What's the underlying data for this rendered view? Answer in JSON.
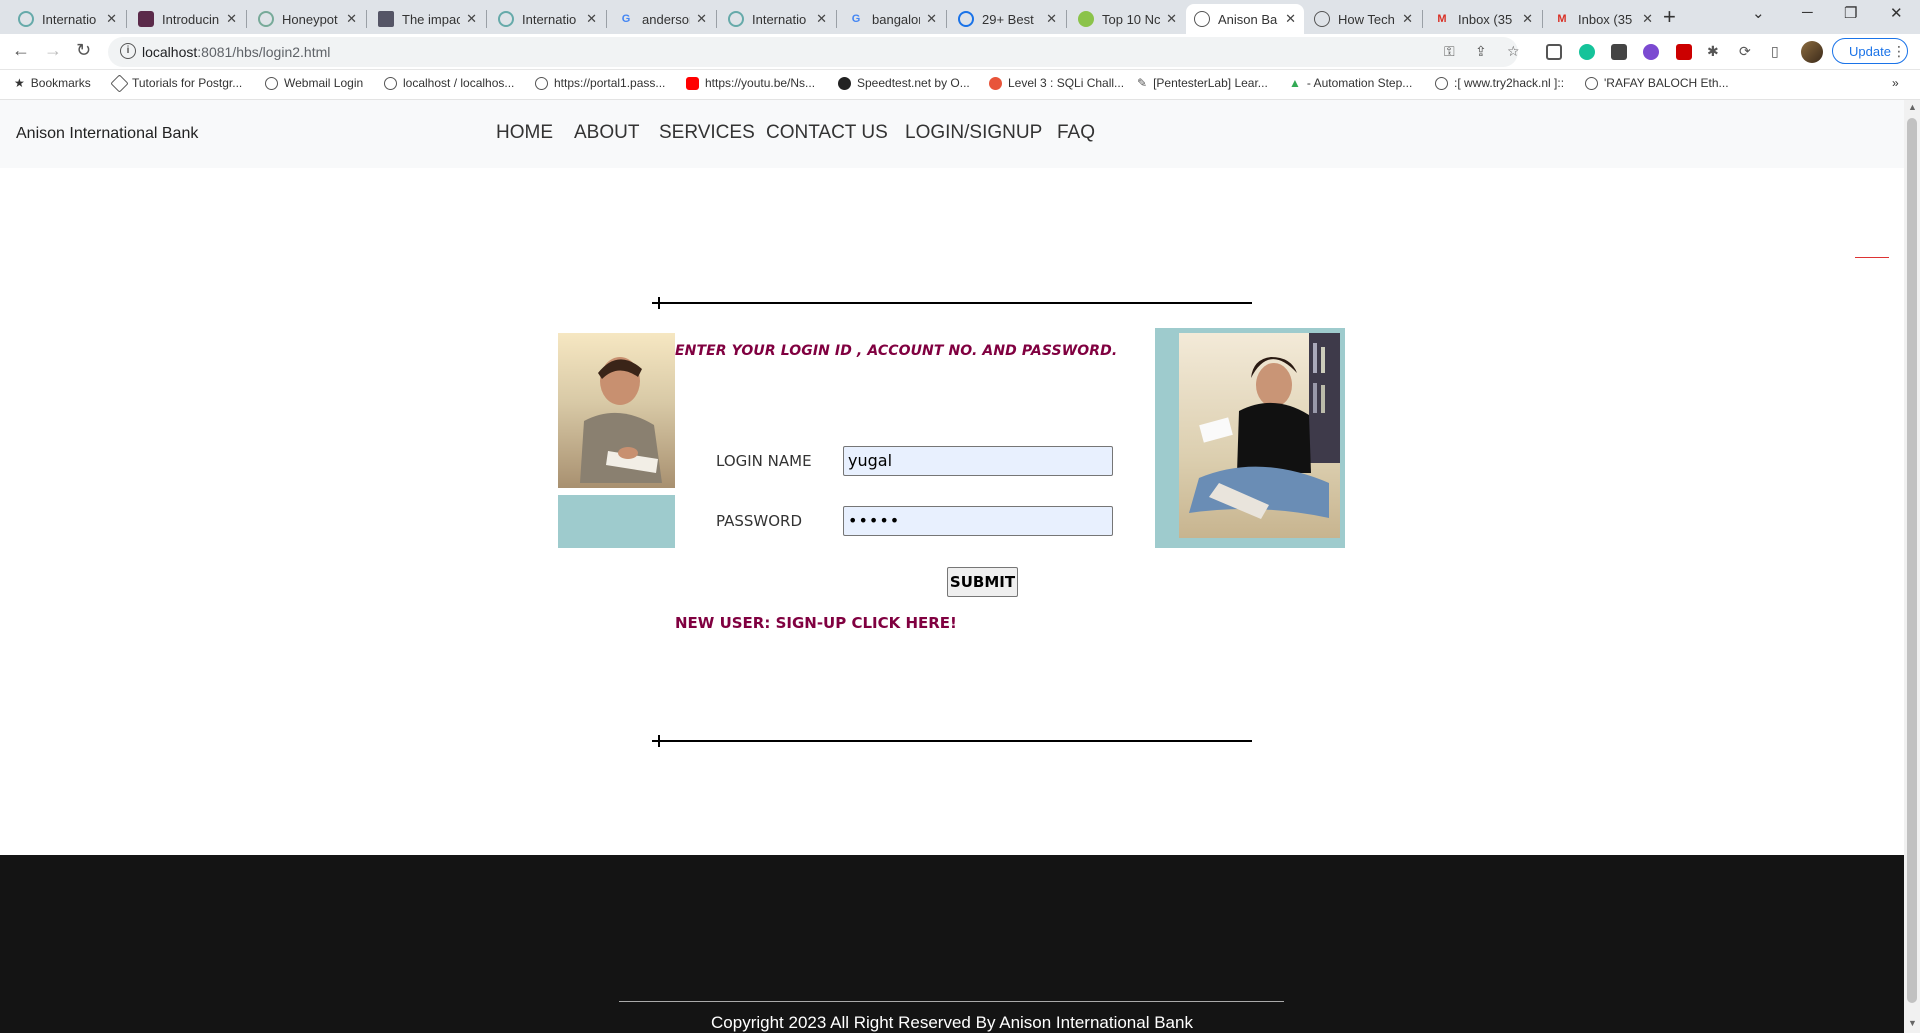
{
  "browser": {
    "tabs": [
      {
        "label": "Internatio",
        "active": false
      },
      {
        "label": "Introducin",
        "active": false
      },
      {
        "label": "Honeypot",
        "active": false
      },
      {
        "label": "The impac",
        "active": false
      },
      {
        "label": "Internatio",
        "active": false
      },
      {
        "label": "anderson",
        "active": false
      },
      {
        "label": "Internatio",
        "active": false
      },
      {
        "label": "bangalore",
        "active": false
      },
      {
        "label": "29+ Best",
        "active": false
      },
      {
        "label": "Top 10 Nc",
        "active": false
      },
      {
        "label": "Anison Ba",
        "active": true
      },
      {
        "label": "How Tech",
        "active": false
      },
      {
        "label": "Inbox (35",
        "active": false
      },
      {
        "label": "Inbox (35",
        "active": false
      }
    ],
    "url": {
      "host": "localhost",
      "rest": ":8081/hbs/login2.html"
    },
    "update_label": "Update",
    "bookmarks": [
      "Bookmarks",
      "Tutorials for Postgr...",
      "Webmail Login",
      "localhost / localhos...",
      "https://portal1.pass...",
      "https://youtu.be/Ns...",
      "Speedtest.net by O...",
      "Level 3 : SQLi Chall...",
      "[PentesterLab] Lear...",
      "- Automation Step...",
      ":[ www.try2hack.nl ]::",
      "'RAFAY BALOCH Eth..."
    ]
  },
  "site": {
    "brand": "Anison International Bank",
    "nav": [
      "HOME",
      "ABOUT",
      "SERVICES",
      "CONTACT US",
      "LOGIN/SIGNUP",
      "FAQ"
    ]
  },
  "login": {
    "heading": "ENTER YOUR LOGIN ID , ACCOUNT NO. AND PASSWORD.",
    "login_name_label": "LOGIN NAME",
    "login_name_value": "yugal",
    "password_label": "PASSWORD",
    "password_value": "•••••",
    "submit_label": "SUBMIT",
    "signup_text": "NEW USER: SIGN-UP CLICK HERE!"
  },
  "footer": {
    "copyright": "Copyright 2023 All Right Reserved By Anison International Bank"
  },
  "colors": {
    "accent_maroon": "#800040",
    "teal_block": "#9ecbcd",
    "footer_bg": "#141414",
    "input_bg": "#e8f0fe"
  }
}
